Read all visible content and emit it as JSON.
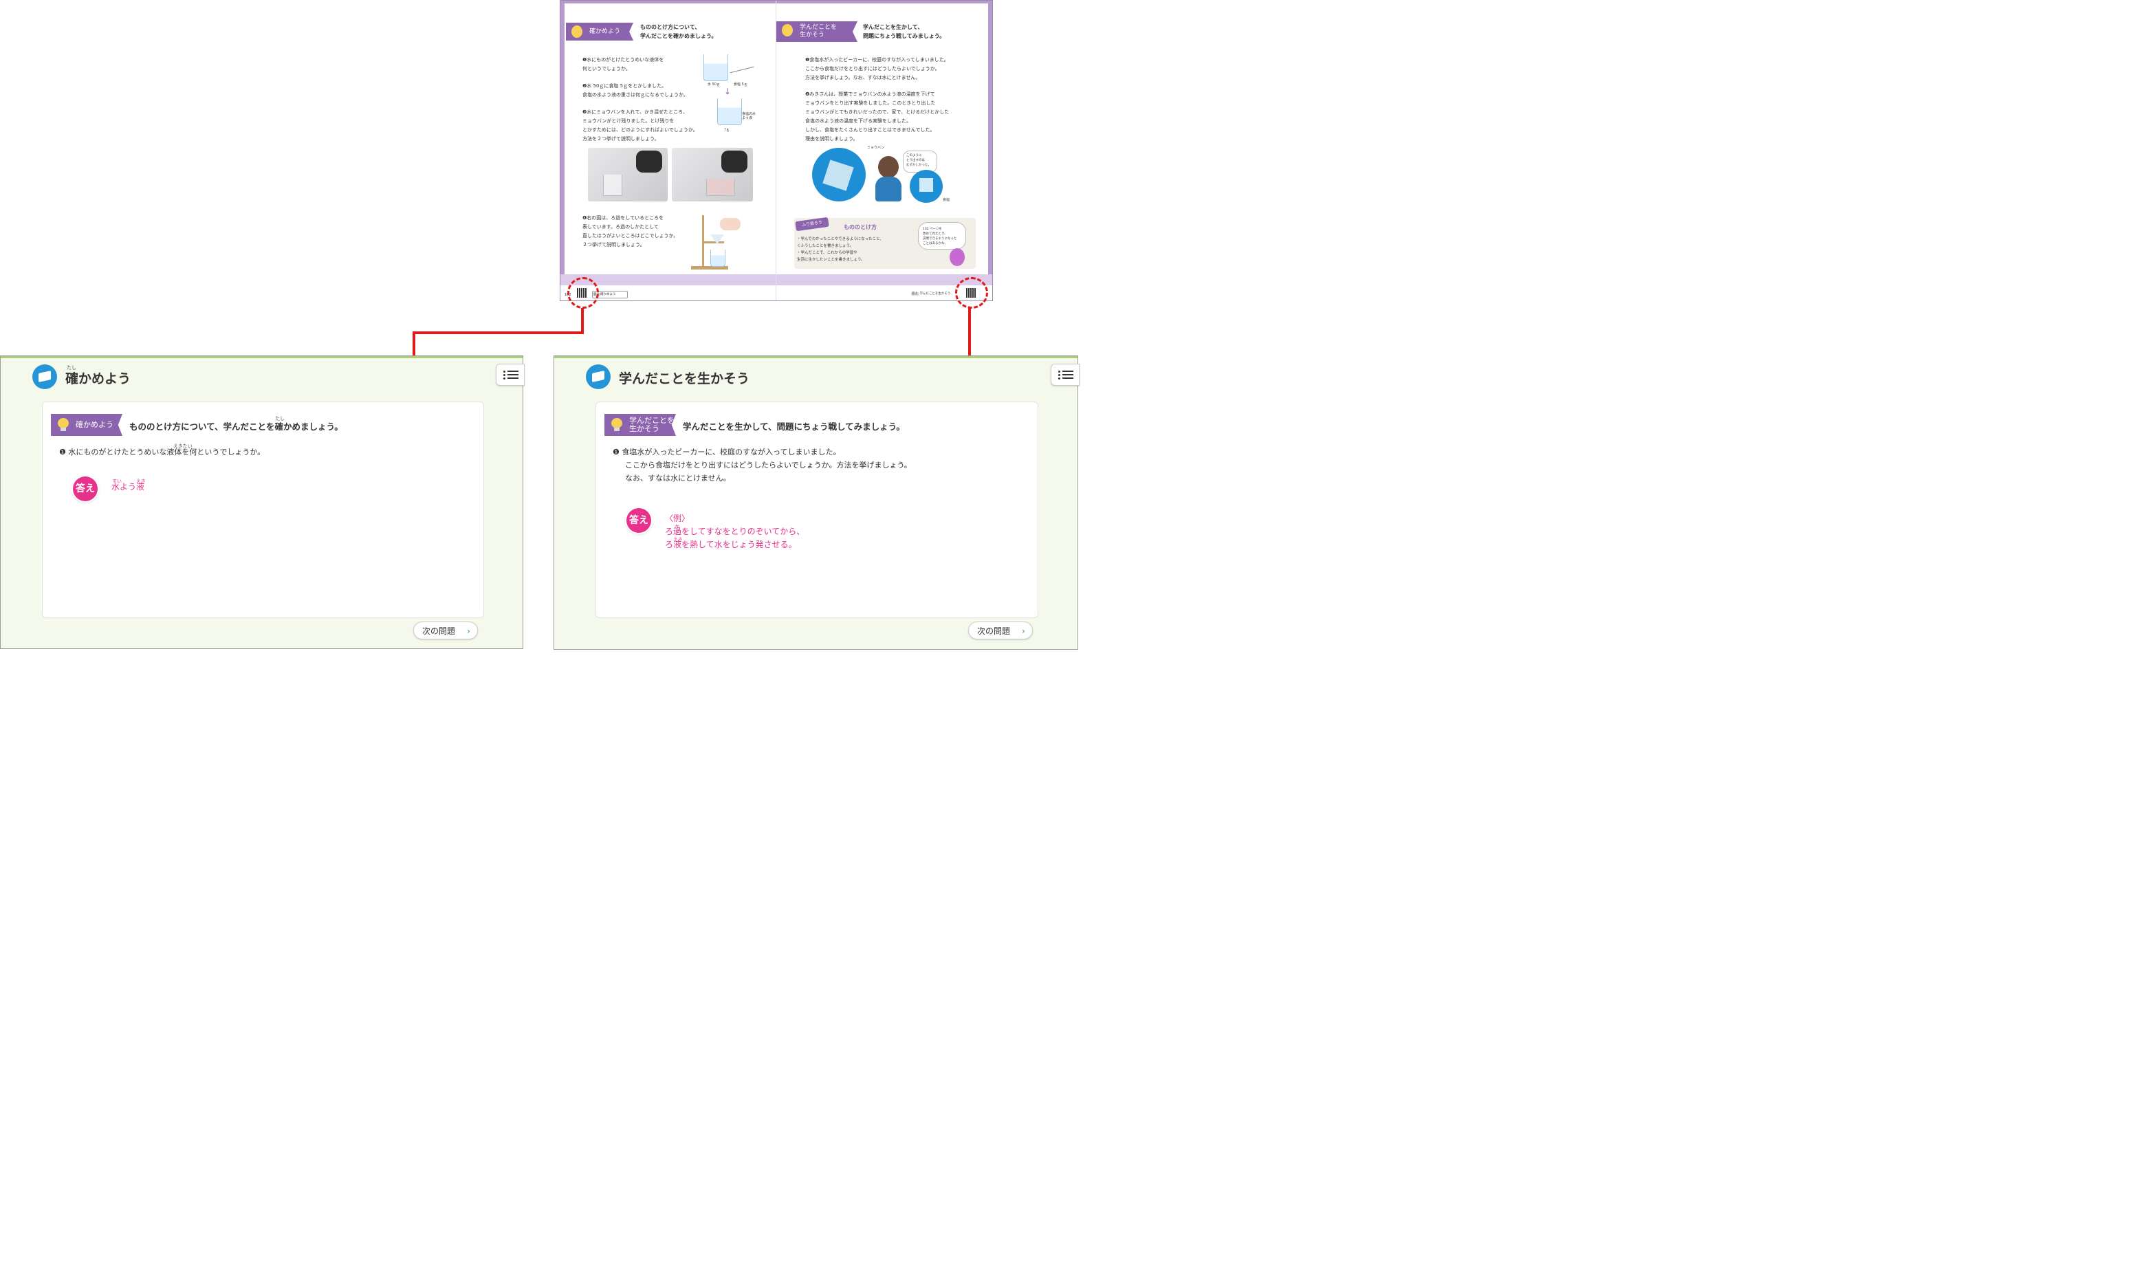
{
  "spread": {
    "left": {
      "ribbon": "確かめよう",
      "lead_line1": "もののとけ方について、",
      "lead_line2": "学んだことを確かめましょう。",
      "q1_line1": "❶水にものがとけたとうめいな液体を",
      "q1_line2": "何というでしょうか。",
      "q2_line1": "❷水 50ｇに食塩 5ｇをとかしました。",
      "q2_line2": "食塩の水よう液の重さは何ｇになるでしょうか。",
      "q3_line1": "❸水にミョウバンを入れて、かき混ぜたところ、",
      "q3_line2": "ミョウバンがとけ残りました。とけ残りを",
      "q3_line3": "とかすためには、どのようにすればよいでしょうか。",
      "q3_line4": "方法を２つ挙げて説明しましょう。",
      "q4_line1": "❹右の図は、ろ過をしているところを",
      "q4_line2": "表しています。ろ過のしかたとして",
      "q4_line3": "直したほうがよいところはどこでしょうか。",
      "q4_line4": "２つ挙げて説明しましょう。",
      "fig_water": "水 50ｇ",
      "fig_salt": "食塩 5ｇ",
      "fig_solution": "食塩の水よう液",
      "fig_q": "?ｇ",
      "page_no": "102",
      "footer_tag": "答え",
      "footer_label": "確かめよう"
    },
    "right": {
      "ribbon_line1": "学んだことを",
      "ribbon_line2": "生かそう",
      "lead_line1": "学んだことを生かして、",
      "lead_line2": "問題にちょう戦してみましょう。",
      "q1_line1": "❶食塩水が入ったビーカーに、校庭のすなが入ってしまいました。",
      "q1_line2": "ここから食塩だけをとり出すにはどうしたらよいでしょうか。",
      "q1_line3": "方法を挙げましょう。なお、すなは水にとけません。",
      "q2_line1": "❷みきさんは、授業でミョウバンの水よう液の温度を下げて",
      "q2_line2": "ミョウバンをとり出す実験をしました。このときとり出した",
      "q2_line3": "ミョウバンがとてもきれいだったので、家で、とけるだけとかした",
      "q2_line4": "食塩の水よう液の温度を下げる実験をしました。",
      "q2_line5": "しかし、食塩をたくさんとり出すことはできませんでした。",
      "q2_line6": "理由を説明しましょう。",
      "fig_alum": "ミョウバン",
      "fig_bubble_line1": "このように",
      "fig_bubble_line2": "とり出すのは",
      "fig_bubble_line3": "むずかしかった。",
      "fig_salt": "食塩",
      "reflect_tag": "ふり返ろう",
      "reflect_title": "もののとけ方",
      "reflect_item1_line1": "・学んでわかったことやできるようになったこと、",
      "reflect_item1_line2": "くふうしたことを書きましょう。",
      "reflect_item2_line1": "・学んだことで、これからの学習や",
      "reflect_item2_line2": "生活に生かしたいことを書きましょう。",
      "reflect_bubble_line1": "102 ページを",
      "reflect_bubble_line2": "改めて見たとき、",
      "reflect_bubble_line3": "説明できるようになった",
      "reflect_bubble_line4": "ことはあるかな。",
      "footer_tag": "答え",
      "footer_label": "学んだことを生かそう"
    }
  },
  "panel_left": {
    "title": "確かめよう",
    "title_ruby": "たし",
    "ribbon_label": "確かめよう",
    "lead": "もののとけ方について、学んだことを確かめましょう。",
    "lead_ruby": "たし",
    "question": "❶ 水にものがとけたとうめいな液体を何というでしょうか。",
    "question_ruby": "えきたい",
    "answer_badge": "答え",
    "answer_ruby": "すい　　　えき",
    "answer": "水よう液",
    "next_label": "次の問題"
  },
  "panel_right": {
    "title": "学んだことを生かそう",
    "ribbon_line1": "学んだことを",
    "ribbon_line2": "生かそう",
    "lead": "学んだことを生かして、問題にちょう戦してみましょう。",
    "q_line1": "❶ 食塩水が入ったビーカーに、校庭のすなが入ってしまいました。",
    "q_line2": "ここから食塩だけをとり出すにはどうしたらよいでしょうか。方法を挙げましょう。",
    "q_line3": "なお、すなは水にとけません。",
    "answer_badge": "答え",
    "answer_example": "〈例〉",
    "answer_ruby1": "か",
    "answer_line1": "ろ過をしてすなをとりのぞいてから、",
    "answer_ruby2": "えき",
    "answer_line2": "ろ液を熱して水をじょう発させる。",
    "next_label": "次の問題"
  },
  "colors": {
    "ribbon_purple": "#8c63ad",
    "answer_pink": "#e8318b",
    "connector_red": "#e01b1b",
    "panel_bg": "#f4f9ec",
    "icon_blue": "#2595d7"
  }
}
